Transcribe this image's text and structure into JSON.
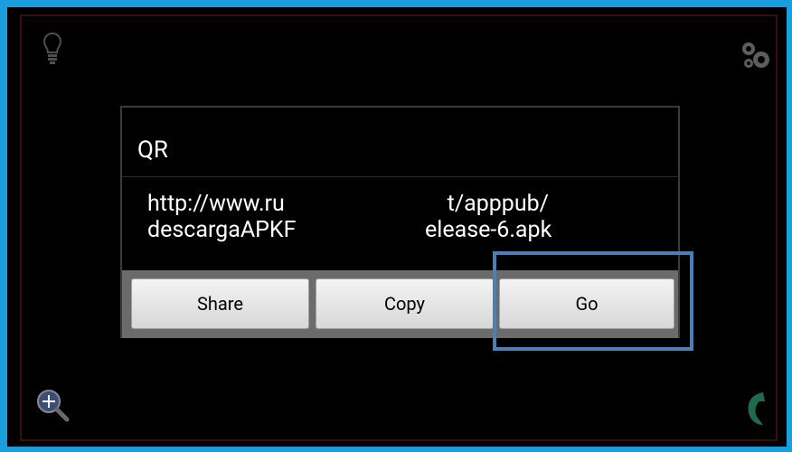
{
  "icons": {
    "bulb": "lightbulb-icon",
    "gears": "settings-gears-icon",
    "zoom": "zoom-in-icon",
    "flip": "camera-switch-icon"
  },
  "dialog": {
    "title": "QR",
    "message": "http://www.ru                             t/apppub/\ndescargaAPKF                       elease-6.apk",
    "buttons": {
      "share": "Share",
      "copy": "Copy",
      "go": "Go"
    }
  },
  "colors": {
    "frame": "#1a9fde",
    "highlight": "#4a7fb9"
  }
}
